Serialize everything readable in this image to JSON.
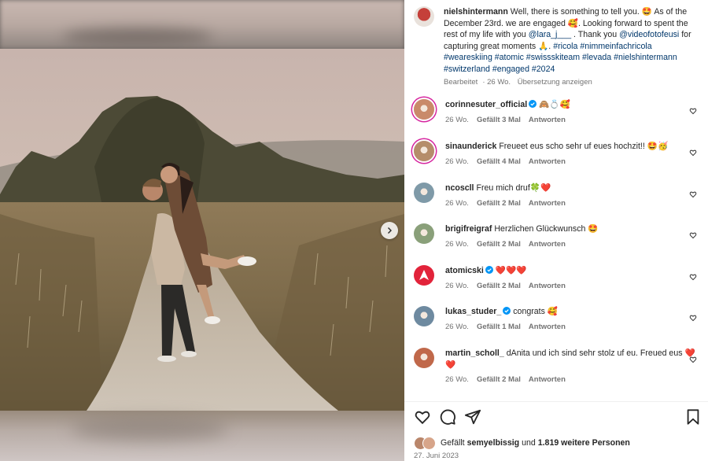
{
  "post": {
    "author": "nielshintermann",
    "caption_parts": [
      {
        "t": "Well, there is something to tell you. 🤩 As of the December 23rd. we are engaged 🥰. Looking forward to spent the rest of my life with you ",
        "tag": false
      },
      {
        "t": "@lara_j___",
        "tag": true
      },
      {
        "t": " . Thank you ",
        "tag": false
      },
      {
        "t": "@videofotofeusi",
        "tag": true
      },
      {
        "t": " for capturing great moments 🙏. ",
        "tag": false
      },
      {
        "t": "#ricola #nimmeinfachricola #weareskiing #atomic #swissskiteam #levada #nielshintermann #switzerland #engaged #2024",
        "tag": true
      }
    ],
    "edited": "Bearbeitet",
    "age": "26 Wo.",
    "translate": "Übersetzung anzeigen"
  },
  "comments": [
    {
      "user": "corinnesuter_official",
      "verified": true,
      "text": "🙈💍🥰",
      "age": "26 Wo.",
      "likes": "Gefällt 3 Mal",
      "reply": "Antworten",
      "avatar_color": "#c98a6a",
      "ring": true
    },
    {
      "user": "sinaunderick",
      "verified": false,
      "text": "Freueet eus scho sehr uf eues hochzit!! 🤩🥳",
      "age": "26 Wo.",
      "likes": "Gefällt 4 Mal",
      "reply": "Antworten",
      "avatar_color": "#b58d6b",
      "ring": true
    },
    {
      "user": "ncoscll",
      "verified": false,
      "text": "Freu mich druf🍀❤️",
      "age": "26 Wo.",
      "likes": "Gefällt 2 Mal",
      "reply": "Antworten",
      "avatar_color": "#7f9aa8",
      "ring": false
    },
    {
      "user": "brigifreigraf",
      "verified": false,
      "text": "Herzlichen Glückwunsch 🤩",
      "age": "26 Wo.",
      "likes": "Gefällt 2 Mal",
      "reply": "Antworten",
      "avatar_color": "#8aa07a",
      "ring": false
    },
    {
      "user": "atomicski",
      "verified": true,
      "text": "❤️❤️❤️",
      "age": "26 Wo.",
      "likes": "Gefällt 2 Mal",
      "reply": "Antworten",
      "avatar_color": "#e2233a",
      "ring": false
    },
    {
      "user": "lukas_studer_",
      "verified": true,
      "text": "congrats 🥰",
      "age": "26 Wo.",
      "likes": "Gefällt 1 Mal",
      "reply": "Antworten",
      "avatar_color": "#6e8aa0",
      "ring": false
    },
    {
      "user": "martin_scholl_",
      "verified": false,
      "text": "dAnita und ich sind sehr stolz uf eu. Freued eus ❤️❤️",
      "age": "26 Wo.",
      "likes": "Gefällt 2 Mal",
      "reply": "Antworten",
      "avatar_color": "#c0684a",
      "ring": false
    }
  ],
  "likes_line": {
    "prefix": "Gefällt",
    "user": "semyelbissig",
    "middle": "und",
    "count": "1.819 weitere Personen"
  },
  "date": "27. Juni 2023",
  "icons": {
    "like": "heart-icon",
    "comment": "comment-icon",
    "share": "share-icon",
    "save": "bookmark-icon",
    "next": "chevron-right-icon"
  },
  "colors": {
    "tag": "#00376b",
    "muted": "#737373",
    "verified": "#0095f6",
    "ring": "#d6249f"
  }
}
